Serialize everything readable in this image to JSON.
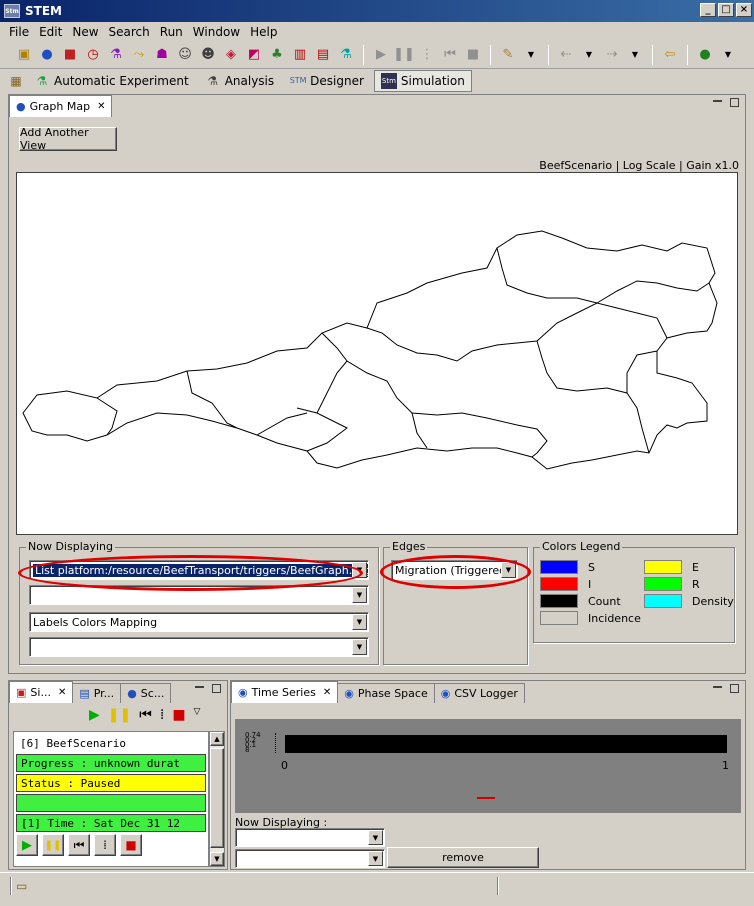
{
  "window": {
    "title": "STEM",
    "app_icon": "stem-logo-icon"
  },
  "menu": [
    "File",
    "Edit",
    "New",
    "Search",
    "Run",
    "Window",
    "Help"
  ],
  "perspectives": [
    {
      "label": "Automatic Experiment",
      "icon": "experiment-icon"
    },
    {
      "label": "Analysis",
      "icon": "analysis-icon"
    },
    {
      "label": "Designer",
      "icon": "designer-icon"
    },
    {
      "label": "Simulation",
      "icon": "simulation-icon"
    }
  ],
  "graph_map": {
    "tab_label": "Graph Map",
    "add_view_label": "Add Another View",
    "info_line": "BeefScenario | Log Scale | Gain x1.0",
    "now_displaying_label": "Now Displaying",
    "combo1_value": "List platform:/resource/BeefTransport/triggers/BeefGraph.trigger",
    "combo2_value": "",
    "combo3_value": "Labels Colors Mapping",
    "combo4_value": "",
    "edges_label": "Edges",
    "edges_value": "Migration (Triggered)",
    "legend_label": "Colors Legend",
    "legend": [
      {
        "label": "S",
        "color": "#0000ff"
      },
      {
        "label": "E",
        "color": "#ffff00"
      },
      {
        "label": "I",
        "color": "#ff0000"
      },
      {
        "label": "R",
        "color": "#00ff00"
      },
      {
        "label": "Count",
        "color": "#000000"
      },
      {
        "label": "Density",
        "color": "#00ffff"
      },
      {
        "label": "Incidence",
        "color": "#d4d0c8"
      }
    ]
  },
  "sim_panel": {
    "tabs": [
      "Si...",
      "Pr...",
      "Sc..."
    ],
    "lines": [
      "[6] BeefScenario",
      "Progress : unknown durat",
      "Status : Paused",
      "",
      "[1] Time : Sat Dec 31 12"
    ]
  },
  "ts_panel": {
    "tabs": [
      "Time Series",
      "Phase Space",
      "CSV Logger"
    ],
    "y_ticks": [
      "0.74",
      "0.2",
      "0.1",
      "8"
    ],
    "x_ticks": [
      "0",
      "1"
    ],
    "now_displaying_label": "Now Displaying :",
    "select1_value": "",
    "select2_value": "",
    "remove_label": "remove"
  }
}
